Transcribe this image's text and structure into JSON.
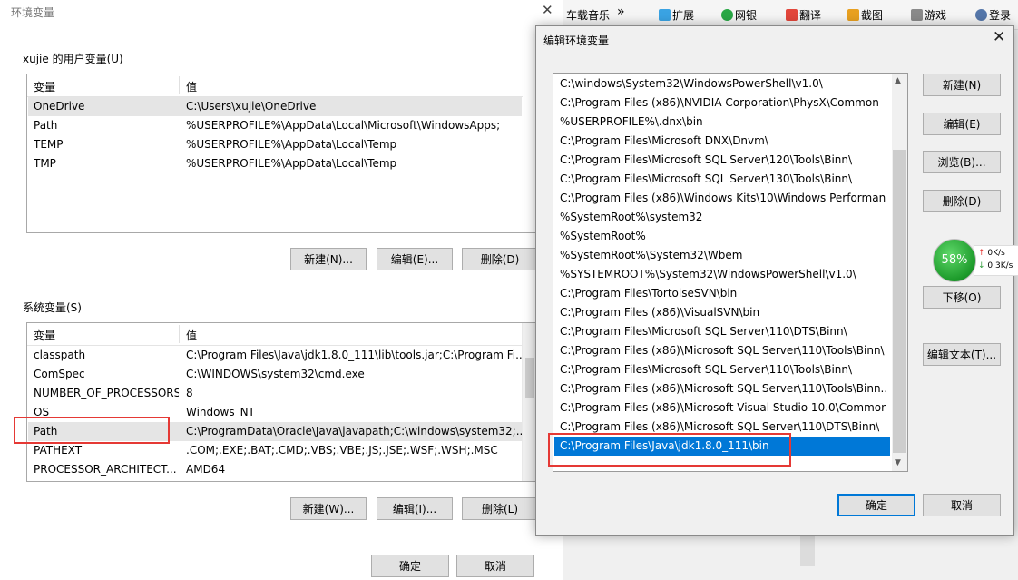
{
  "background_window": {
    "title": "环境变量",
    "user_group_label": "xujie 的用户变量(U)",
    "system_group_label": "系统变量(S)",
    "col_var": "变量",
    "col_val": "值",
    "user_vars": [
      {
        "name": "OneDrive",
        "value": "C:\\Users\\xujie\\OneDrive"
      },
      {
        "name": "Path",
        "value": "%USERPROFILE%\\AppData\\Local\\Microsoft\\WindowsApps;"
      },
      {
        "name": "TEMP",
        "value": "%USERPROFILE%\\AppData\\Local\\Temp"
      },
      {
        "name": "TMP",
        "value": "%USERPROFILE%\\AppData\\Local\\Temp"
      }
    ],
    "user_buttons": {
      "new": "新建(N)...",
      "edit": "编辑(E)...",
      "delete": "删除(D)"
    },
    "system_vars": [
      {
        "name": "classpath",
        "value": "C:\\Program Files\\Java\\jdk1.8.0_111\\lib\\tools.jar;C:\\Program Fi..."
      },
      {
        "name": "ComSpec",
        "value": "C:\\WINDOWS\\system32\\cmd.exe"
      },
      {
        "name": "NUMBER_OF_PROCESSORS",
        "value": "8"
      },
      {
        "name": "OS",
        "value": "Windows_NT"
      },
      {
        "name": "Path",
        "value": "C:\\ProgramData\\Oracle\\Java\\javapath;C:\\windows\\system32;..."
      },
      {
        "name": "PATHEXT",
        "value": ".COM;.EXE;.BAT;.CMD;.VBS;.VBE;.JS;.JSE;.WSF;.WSH;.MSC"
      },
      {
        "name": "PROCESSOR_ARCHITECT...",
        "value": "AMD64"
      }
    ],
    "system_buttons": {
      "new": "新建(W)...",
      "edit": "编辑(I)...",
      "delete": "删除(L)"
    },
    "ok": "确定",
    "cancel": "取消"
  },
  "taskbar_strip": {
    "items": [
      "车载音乐",
      "扩展",
      "网银",
      "翻译",
      "截图",
      "游戏",
      "登录"
    ],
    "overflow": "»"
  },
  "edit_dialog": {
    "title": "编辑环境变量",
    "paths": [
      "C:\\windows\\System32\\WindowsPowerShell\\v1.0\\",
      "C:\\Program Files (x86)\\NVIDIA Corporation\\PhysX\\Common",
      "%USERPROFILE%\\.dnx\\bin",
      "C:\\Program Files\\Microsoft DNX\\Dnvm\\",
      "C:\\Program Files\\Microsoft SQL Server\\120\\Tools\\Binn\\",
      "C:\\Program Files\\Microsoft SQL Server\\130\\Tools\\Binn\\",
      "C:\\Program Files (x86)\\Windows Kits\\10\\Windows Performan...",
      "%SystemRoot%\\system32",
      "%SystemRoot%",
      "%SystemRoot%\\System32\\Wbem",
      "%SYSTEMROOT%\\System32\\WindowsPowerShell\\v1.0\\",
      "C:\\Program Files\\TortoiseSVN\\bin",
      "C:\\Program Files (x86)\\VisualSVN\\bin",
      "C:\\Program Files\\Microsoft SQL Server\\110\\DTS\\Binn\\",
      "C:\\Program Files (x86)\\Microsoft SQL Server\\110\\Tools\\Binn\\",
      "C:\\Program Files\\Microsoft SQL Server\\110\\Tools\\Binn\\",
      "C:\\Program Files (x86)\\Microsoft SQL Server\\110\\Tools\\Binn...",
      "C:\\Program Files (x86)\\Microsoft Visual Studio 10.0\\Common...",
      "C:\\Program Files (x86)\\Microsoft SQL Server\\110\\DTS\\Binn\\",
      "C:\\Program Files\\Java\\jdk1.8.0_111\\bin"
    ],
    "buttons": {
      "new": "新建(N)",
      "edit": "编辑(E)",
      "browse": "浏览(B)...",
      "delete": "删除(D)",
      "move_down": "下移(O)",
      "edit_text": "编辑文本(T)..."
    },
    "ok": "确定",
    "cancel": "取消"
  },
  "speed_widget": {
    "percent": "58%",
    "up": "0K/s",
    "down": "0.3K/s",
    "up_arrow": "↑",
    "down_arrow": "↓"
  },
  "colors": {
    "selection": "#0078d7",
    "highlight_box": "#e53935",
    "widget_green": "#1c9a2a"
  }
}
